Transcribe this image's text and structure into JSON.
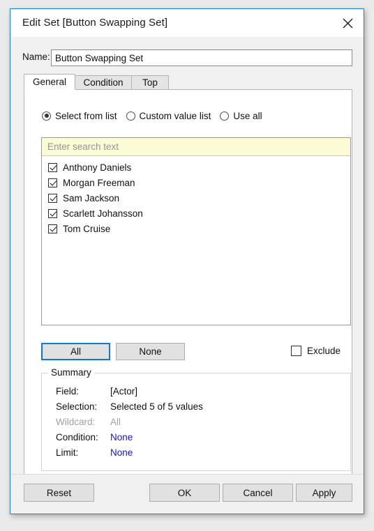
{
  "window": {
    "title": "Edit Set [Button Swapping Set]",
    "close_icon": "close-icon"
  },
  "name_row": {
    "label": "Name:",
    "value": "Button Swapping Set",
    "placeholder": ""
  },
  "tabs": [
    {
      "id": "general",
      "label": "General",
      "active": true
    },
    {
      "id": "condition",
      "label": "Condition",
      "active": false
    },
    {
      "id": "top",
      "label": "Top",
      "active": false
    }
  ],
  "mode_options": [
    {
      "label": "Select from list",
      "selected": true
    },
    {
      "label": "Custom value list",
      "selected": false
    },
    {
      "label": "Use all",
      "selected": false
    }
  ],
  "search": {
    "placeholder": "Enter search text",
    "value": ""
  },
  "list_items": [
    {
      "label": "Anthony Daniels",
      "checked": true
    },
    {
      "label": "Morgan Freeman",
      "checked": true
    },
    {
      "label": "Sam Jackson",
      "checked": true
    },
    {
      "label": "Scarlett Johansson",
      "checked": true
    },
    {
      "label": "Tom Cruise",
      "checked": true
    }
  ],
  "selection_buttons": {
    "all": "All",
    "none": "None"
  },
  "exclude": {
    "label": "Exclude",
    "checked": false
  },
  "summary": {
    "legend": "Summary",
    "rows": [
      {
        "key": "Field:",
        "value": "[Actor]",
        "style": "normal"
      },
      {
        "key": "Selection:",
        "value": "Selected 5 of 5 values",
        "style": "normal"
      },
      {
        "key": "Wildcard:",
        "value": "All",
        "style": "disabled"
      },
      {
        "key": "Condition:",
        "value": "None",
        "style": "link"
      },
      {
        "key": "Limit:",
        "value": "None",
        "style": "link"
      }
    ]
  },
  "footer_buttons": {
    "reset": "Reset",
    "ok": "OK",
    "cancel": "Cancel",
    "apply": "Apply"
  },
  "colors": {
    "window_border": "#1884d8",
    "focus_border": "#0d7bd4",
    "search_background": "#fbfbd6",
    "link": "#1414cf",
    "disabled_text": "#a0a0a0"
  }
}
